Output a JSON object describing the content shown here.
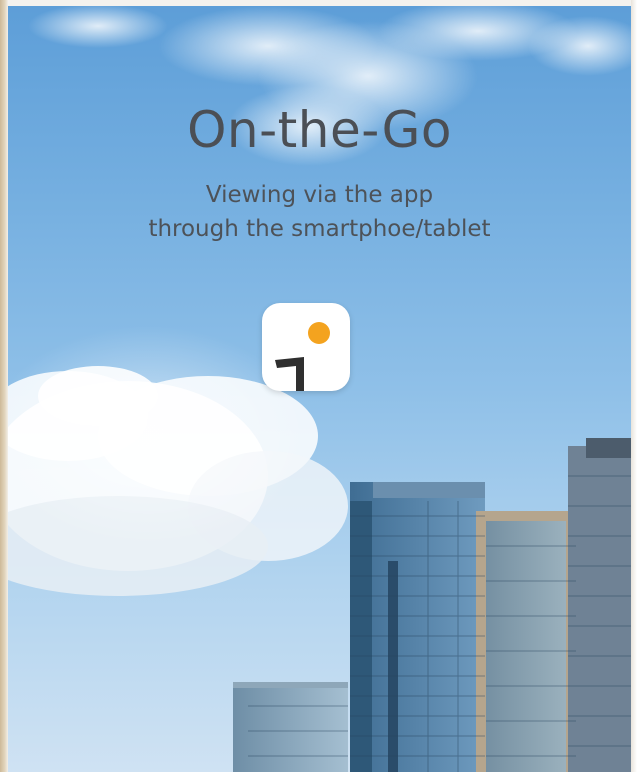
{
  "headline": "On-the-Go",
  "subtitle": {
    "line1": "Viewing via the app",
    "line2": "through the smartphoe/tablet"
  },
  "app_icon": {
    "name": "app-logo-icon",
    "dot_color": "#f4a31f",
    "mark_color": "#2f2f2f"
  },
  "colors": {
    "sky_top": "#5d9ed8",
    "sky_bottom": "#cfe2f3",
    "text": "#4b4f55"
  }
}
